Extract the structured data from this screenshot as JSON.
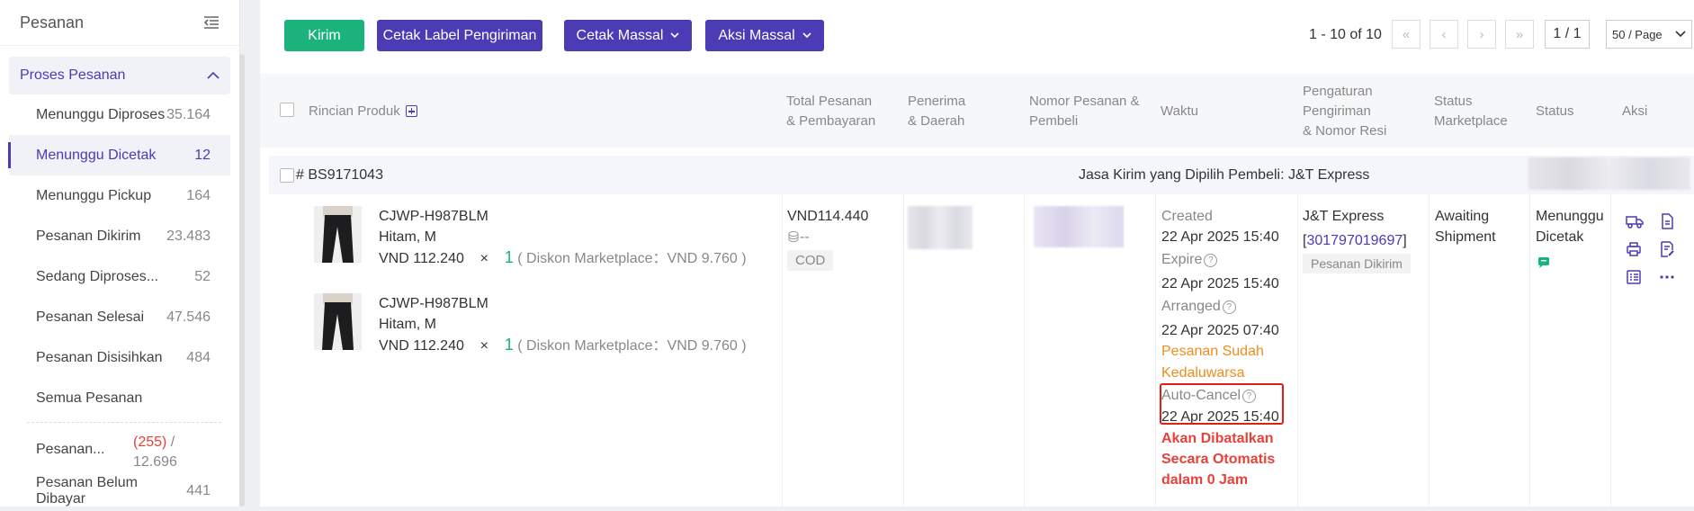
{
  "sidebar": {
    "title": "Pesanan",
    "group": "Proses Pesanan",
    "items": [
      {
        "label": "Menunggu Diproses",
        "count": "35.164"
      },
      {
        "label": "Menunggu Dicetak",
        "count": "12"
      },
      {
        "label": "Menunggu Pickup",
        "count": "164"
      },
      {
        "label": "Pesanan Dikirim",
        "count": "23.483"
      },
      {
        "label": "Sedang Diproses...",
        "count": "52"
      },
      {
        "label": "Pesanan Selesai",
        "count": "47.546"
      },
      {
        "label": "Pesanan Disisihkan",
        "count": "484"
      },
      {
        "label": "Semua Pesanan",
        "count": ""
      }
    ],
    "extra": [
      {
        "label": "Pesanan...",
        "count_red": "(255)",
        "count_sep": " / ",
        "count_total": "12.696"
      },
      {
        "label": "Pesanan Belum Dibayar",
        "count": "441"
      }
    ]
  },
  "toolbar": {
    "kirim": "Kirim",
    "cetak_label": "Cetak Label Pengiriman",
    "cetak_massal": "Cetak Massal",
    "aksi_massal": "Aksi Massal",
    "range": "1 - 10 of 10",
    "page_input": "1 / 1",
    "page_size": "50 / Page"
  },
  "table": {
    "headers": {
      "produk": "Rincian Produk",
      "total": [
        "Total Pesanan",
        "& Pembayaran"
      ],
      "penerima": [
        "Penerima",
        "& Daerah"
      ],
      "nomor": [
        "Nomor Pesanan &",
        "Pembeli"
      ],
      "waktu": "Waktu",
      "pengaturan": [
        "Pengaturan",
        "Pengiriman",
        "& Nomor Resi"
      ],
      "status_mp": [
        "Status",
        "Marketplace"
      ],
      "status": "Status",
      "aksi": "Aksi"
    }
  },
  "order": {
    "id": "# BS9171043",
    "courier_text": "Jasa Kirim yang Dipilih Pembeli: J&T Express",
    "products": [
      {
        "sku": "CJWP-H987BLM",
        "variant": "Hitam, M",
        "price": "VND 112.240",
        "times": "×",
        "qty": "1",
        "discount": "( Diskon Marketplace：VND 9.760 )"
      },
      {
        "sku": "CJWP-H987BLM",
        "variant": "Hitam, M",
        "price": "VND 112.240",
        "times": "×",
        "qty": "1",
        "discount": "( Diskon Marketplace：VND 9.760 )"
      }
    ],
    "total": "VND114.440",
    "payment_dash": "--",
    "payment_method": "COD",
    "times": {
      "created_label": "Created",
      "created": "22 Apr 2025 15:40",
      "expire_label": "Expire",
      "expire": "22 Apr 2025 15:40",
      "arranged_label": "Arranged",
      "arranged": "22 Apr 2025 07:40",
      "expired_note_1": "Pesanan Sudah",
      "expired_note_2": "Kedaluwarsa",
      "autocancel_label": "Auto-Cancel",
      "autocancel": "22 Apr 2025 15:40",
      "warn_1": "Akan Dibatalkan",
      "warn_2": "Secara Otomatis",
      "warn_3": "dalam 0 Jam"
    },
    "shipping": {
      "carrier": "J&T Express",
      "resi_open": "[",
      "resi": "301797019697",
      "resi_close": "]",
      "tag": "Pesanan Dikirim"
    },
    "status_marketplace": [
      "Awaiting",
      "Shipment"
    ],
    "status": [
      "Menunggu",
      "Dicetak"
    ],
    "colors": {
      "accent": "#4b3bb5",
      "green": "#1bb37b",
      "red": "#e8413a",
      "orange": "#f08c1b"
    }
  }
}
